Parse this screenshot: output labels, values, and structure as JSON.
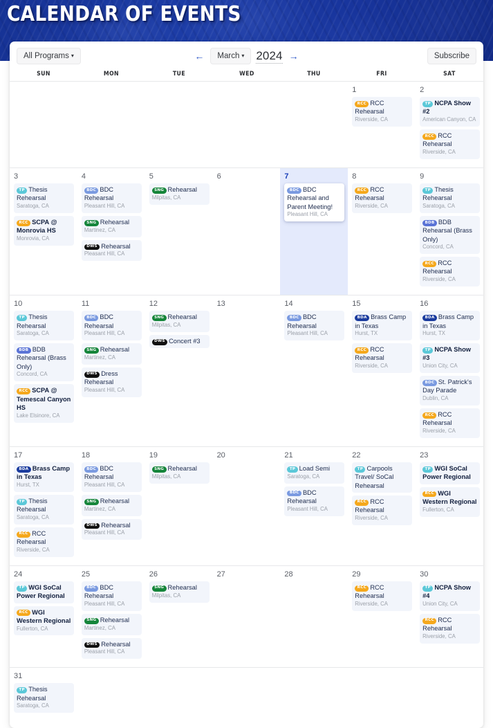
{
  "hero": {
    "title": "CALENDAR OF EVENTS"
  },
  "toolbar": {
    "programs_label": "All Programs",
    "caret": "▾",
    "prev_arrow": "←",
    "next_arrow": "→",
    "month_label": "March",
    "year_label": "2024",
    "subscribe_label": "Subscribe"
  },
  "weekday_headers": [
    "SUN",
    "MON",
    "TUE",
    "WED",
    "THU",
    "FRI",
    "SAT"
  ],
  "badge_colors": {
    "TP": "#5bc8d8",
    "RCC": "#f5a81c",
    "BDC": "#7a9ae0",
    "SNG": "#15853a",
    "DWS": "#111111",
    "BDB": "#5b74d6",
    "BDA": "#1a3b9e"
  },
  "weeks": [
    {
      "days": [
        {
          "num": "",
          "today": false,
          "events": []
        },
        {
          "num": "",
          "today": false,
          "events": []
        },
        {
          "num": "",
          "today": false,
          "events": []
        },
        {
          "num": "",
          "today": false,
          "events": []
        },
        {
          "num": "",
          "today": false,
          "events": []
        },
        {
          "num": "1",
          "today": false,
          "events": [
            {
              "badge": "RCC",
              "title": "RCC Rehearsal",
              "loc": "Riverside, CA",
              "bold": false
            }
          ]
        },
        {
          "num": "2",
          "today": false,
          "events": [
            {
              "badge": "TP",
              "title": "NCPA Show #2",
              "loc": "American Canyon, CA",
              "bold": true
            },
            {
              "badge": "RCC",
              "title": "RCC Rehearsal",
              "loc": "Riverside, CA",
              "bold": false
            }
          ]
        }
      ]
    },
    {
      "days": [
        {
          "num": "3",
          "today": false,
          "events": [
            {
              "badge": "TP",
              "title": "Thesis Rehearsal",
              "loc": "Saratoga, CA",
              "bold": false
            },
            {
              "badge": "RCC",
              "title": "SCPA @ Monrovia HS",
              "loc": "Monrovia, CA",
              "bold": true
            }
          ]
        },
        {
          "num": "4",
          "today": false,
          "events": [
            {
              "badge": "BDC",
              "title": "BDC Rehearsal",
              "loc": "Pleasant Hill, CA",
              "bold": false
            },
            {
              "badge": "SNG",
              "title": "Rehearsal",
              "loc": "Martinez, CA",
              "bold": false
            },
            {
              "badge": "DWS",
              "title": "Rehearsal",
              "loc": "Pleasant Hill, CA",
              "bold": false
            }
          ]
        },
        {
          "num": "5",
          "today": false,
          "events": [
            {
              "badge": "SNG",
              "title": "Rehearsal",
              "loc": "Milpitas, CA",
              "bold": false
            }
          ]
        },
        {
          "num": "6",
          "today": false,
          "events": []
        },
        {
          "num": "7",
          "today": true,
          "events": [
            {
              "badge": "BDC",
              "title": "BDC Rehearsal and Parent Meeting!",
              "loc": "Pleasant Hill, CA",
              "bold": false
            }
          ]
        },
        {
          "num": "8",
          "today": false,
          "events": [
            {
              "badge": "RCC",
              "title": "RCC Rehearsal",
              "loc": "Riverside, CA",
              "bold": false
            }
          ]
        },
        {
          "num": "9",
          "today": false,
          "events": [
            {
              "badge": "TP",
              "title": "Thesis Rehearsal",
              "loc": "Saratoga, CA",
              "bold": false
            },
            {
              "badge": "BDB",
              "title": "BDB Rehearsal (Brass Only)",
              "loc": "Concord, CA",
              "bold": false
            },
            {
              "badge": "RCC",
              "title": "RCC Rehearsal",
              "loc": "Riverside, CA",
              "bold": false
            }
          ]
        }
      ]
    },
    {
      "days": [
        {
          "num": "10",
          "today": false,
          "events": [
            {
              "badge": "TP",
              "title": "Thesis Rehearsal",
              "loc": "Saratoga, CA",
              "bold": false
            },
            {
              "badge": "BDB",
              "title": "BDB Rehearsal (Brass Only)",
              "loc": "Concord, CA",
              "bold": false
            },
            {
              "badge": "RCC",
              "title": "SCPA @ Temescal Canyon HS",
              "loc": "Lake Elsinore, CA",
              "bold": true
            }
          ]
        },
        {
          "num": "11",
          "today": false,
          "events": [
            {
              "badge": "BDC",
              "title": "BDC Rehearsal",
              "loc": "Pleasant Hill, CA",
              "bold": false
            },
            {
              "badge": "SNG",
              "title": "Rehearsal",
              "loc": "Martinez, CA",
              "bold": false
            },
            {
              "badge": "DWS",
              "title": "Dress Rehearsal",
              "loc": "Pleasant Hill, CA",
              "bold": false
            }
          ]
        },
        {
          "num": "12",
          "today": false,
          "events": [
            {
              "badge": "SNG",
              "title": "Rehearsal",
              "loc": "Milpitas, CA",
              "bold": false
            },
            {
              "badge": "DWS",
              "title": "Concert #3",
              "loc": "",
              "bold": false
            }
          ]
        },
        {
          "num": "13",
          "today": false,
          "events": []
        },
        {
          "num": "14",
          "today": false,
          "events": [
            {
              "badge": "BDC",
              "title": "BDC Rehearsal",
              "loc": "Pleasant Hill, CA",
              "bold": false
            }
          ]
        },
        {
          "num": "15",
          "today": false,
          "events": [
            {
              "badge": "BDA",
              "title": "Brass Camp in Texas",
              "loc": "Hurst, TX",
              "bold": false
            },
            {
              "badge": "RCC",
              "title": "RCC Rehearsal",
              "loc": "Riverside, CA",
              "bold": false
            }
          ]
        },
        {
          "num": "16",
          "today": false,
          "events": [
            {
              "badge": "BDA",
              "title": "Brass Camp in Texas",
              "loc": "Hurst, TX",
              "bold": false
            },
            {
              "badge": "TP",
              "title": "NCPA Show #3",
              "loc": "Union City, CA",
              "bold": true
            },
            {
              "badge": "BDC",
              "title": "St. Patrick's Day Parade",
              "loc": "Dublin, CA",
              "bold": false
            },
            {
              "badge": "RCC",
              "title": "RCC Rehearsal",
              "loc": "Riverside, CA",
              "bold": false
            }
          ]
        }
      ]
    },
    {
      "days": [
        {
          "num": "17",
          "today": false,
          "events": [
            {
              "badge": "BDA",
              "title": "Brass Camp in Texas",
              "loc": "Hurst, TX",
              "bold": true
            },
            {
              "badge": "TP",
              "title": "Thesis Rehearsal",
              "loc": "Saratoga, CA",
              "bold": false
            },
            {
              "badge": "RCC",
              "title": "RCC Rehearsal",
              "loc": "Riverside, CA",
              "bold": false
            }
          ]
        },
        {
          "num": "18",
          "today": false,
          "events": [
            {
              "badge": "BDC",
              "title": "BDC Rehearsal",
              "loc": "Pleasant Hill, CA",
              "bold": false
            },
            {
              "badge": "SNG",
              "title": "Rehearsal",
              "loc": "Martinez, CA",
              "bold": false
            },
            {
              "badge": "DWS",
              "title": "Rehearsal",
              "loc": "Pleasant Hill, CA",
              "bold": false
            }
          ]
        },
        {
          "num": "19",
          "today": false,
          "events": [
            {
              "badge": "SNG",
              "title": "Rehearsal",
              "loc": "Milpitas, CA",
              "bold": false
            }
          ]
        },
        {
          "num": "20",
          "today": false,
          "events": []
        },
        {
          "num": "21",
          "today": false,
          "events": [
            {
              "badge": "TP",
              "title": "Load Semi",
              "loc": "Saratoga, CA",
              "bold": false
            },
            {
              "badge": "BDC",
              "title": "BDC Rehearsal",
              "loc": "Pleasant Hill, CA",
              "bold": false
            }
          ]
        },
        {
          "num": "22",
          "today": false,
          "events": [
            {
              "badge": "TP",
              "title": "Carpools Travel/ SoCal Rehearsal",
              "loc": "",
              "bold": false
            },
            {
              "badge": "RCC",
              "title": "RCC Rehearsal",
              "loc": "Riverside, CA",
              "bold": false
            }
          ]
        },
        {
          "num": "23",
          "today": false,
          "events": [
            {
              "badge": "TP",
              "title": "WGI SoCal Power Regional",
              "loc": "",
              "bold": true
            },
            {
              "badge": "RCC",
              "title": "WGI Western Regional",
              "loc": "Fullerton, CA",
              "bold": true
            }
          ]
        }
      ]
    },
    {
      "days": [
        {
          "num": "24",
          "today": false,
          "events": [
            {
              "badge": "TP",
              "title": "WGI SoCal Power Regional",
              "loc": "",
              "bold": true
            },
            {
              "badge": "RCC",
              "title": "WGI Western Regional",
              "loc": "Fullerton, CA",
              "bold": true
            }
          ]
        },
        {
          "num": "25",
          "today": false,
          "events": [
            {
              "badge": "BDC",
              "title": "BDC Rehearsal",
              "loc": "Pleasant Hill, CA",
              "bold": false
            },
            {
              "badge": "SNG",
              "title": "Rehearsal",
              "loc": "Martinez, CA",
              "bold": false
            },
            {
              "badge": "DWS",
              "title": "Rehearsal",
              "loc": "Pleasant Hill, CA",
              "bold": false
            }
          ]
        },
        {
          "num": "26",
          "today": false,
          "events": [
            {
              "badge": "SNG",
              "title": "Rehearsal",
              "loc": "Milpitas, CA",
              "bold": false
            }
          ]
        },
        {
          "num": "27",
          "today": false,
          "events": []
        },
        {
          "num": "28",
          "today": false,
          "events": []
        },
        {
          "num": "29",
          "today": false,
          "events": [
            {
              "badge": "RCC",
              "title": "RCC Rehearsal",
              "loc": "Riverside, CA",
              "bold": false
            }
          ]
        },
        {
          "num": "30",
          "today": false,
          "events": [
            {
              "badge": "TP",
              "title": "NCPA Show #4",
              "loc": "Union City, CA",
              "bold": true
            },
            {
              "badge": "RCC",
              "title": "RCC Rehearsal",
              "loc": "Riverside, CA",
              "bold": false
            }
          ]
        }
      ]
    },
    {
      "days": [
        {
          "num": "31",
          "today": false,
          "events": [
            {
              "badge": "TP",
              "title": "Thesis Rehearsal",
              "loc": "Saratoga, CA",
              "bold": false
            }
          ]
        },
        {
          "num": "",
          "today": false,
          "events": []
        },
        {
          "num": "",
          "today": false,
          "events": []
        },
        {
          "num": "",
          "today": false,
          "events": []
        },
        {
          "num": "",
          "today": false,
          "events": []
        },
        {
          "num": "",
          "today": false,
          "events": []
        },
        {
          "num": "",
          "today": false,
          "events": []
        }
      ]
    }
  ]
}
